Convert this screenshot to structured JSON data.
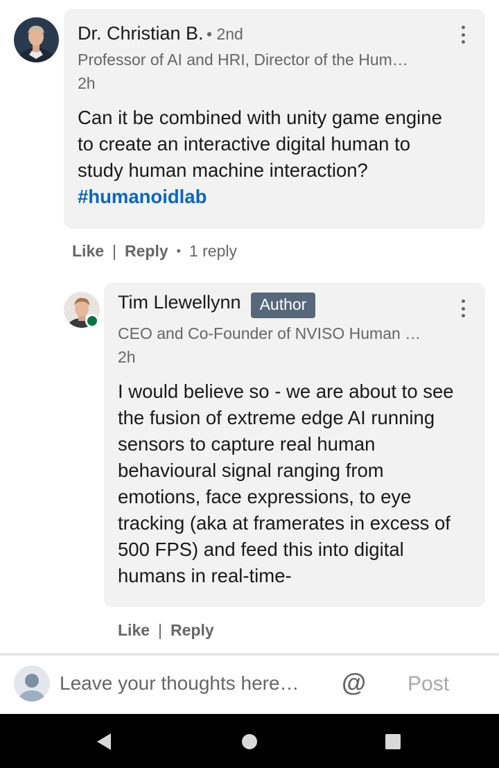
{
  "comments": [
    {
      "author": "Dr. Christian B.",
      "degree": "• 2nd",
      "headline": "Professor of AI and HRI, Director of the Hum…",
      "time": "2h",
      "body": "Can it be combined with unity game engine to create an interactive digital human to study human machine interaction? ",
      "hashtag": "#humanoidlab",
      "like_label": "Like",
      "reply_label": "Reply",
      "reply_count": "1 reply"
    }
  ],
  "reply": {
    "author": "Tim Llewellynn",
    "badge": "Author",
    "headline": "CEO and Co-Founder of NVISO Human …",
    "time": "2h",
    "body": "I would believe so - we are about to see the fusion of extreme edge AI running sensors to capture real human behavioural signal ranging from emotions, face expressions, to eye tracking (aka at framerates in excess of 500 FPS) and feed this into digital humans in real-time-",
    "like_label": "Like",
    "reply_label": "Reply",
    "online_status_color": "#057642"
  },
  "composer": {
    "placeholder": "Leave your thoughts here…",
    "mention_icon": "at-icon",
    "post_label": "Post"
  },
  "icons": {
    "more": "more-vertical-icon",
    "back": "back-triangle-icon",
    "home": "home-circle-icon",
    "recents": "recents-square-icon"
  },
  "colors": {
    "hashtag": "#0a66c2",
    "badge_bg": "#56687a",
    "bubble_bg": "#f2f2f2"
  }
}
